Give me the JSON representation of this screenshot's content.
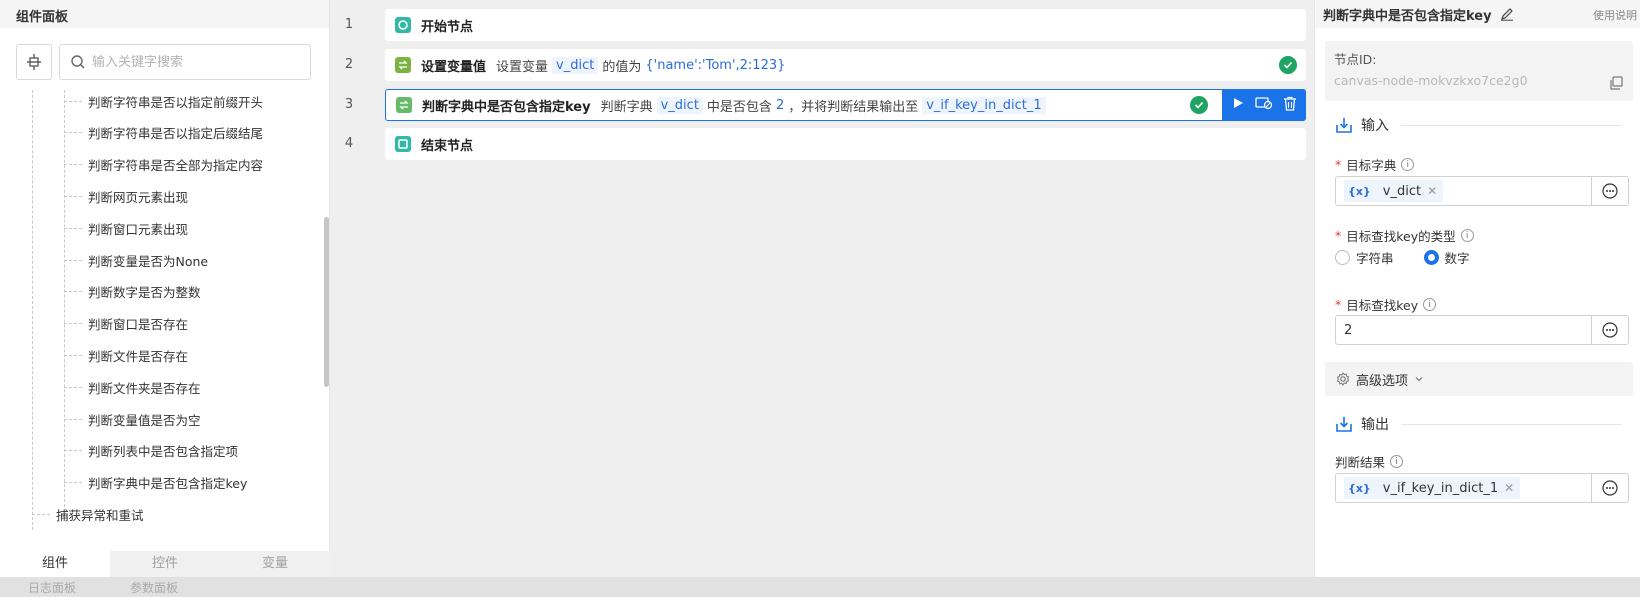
{
  "left_panel": {
    "title": "组件面板",
    "search_placeholder": "输入关键字搜索",
    "tree_items": [
      "判断字符串是否以指定前缀开头",
      "判断字符串是否以指定后缀结尾",
      "判断字符串是否全部为指定内容",
      "判断网页元素出现",
      "判断窗口元素出现",
      "判断变量是否为None",
      "判断数字是否为整数",
      "判断窗口是否存在",
      "判断文件是否存在",
      "判断文件夹是否存在",
      "判断变量值是否为空",
      "判断列表中是否包含指定项",
      "判断字典中是否包含指定key"
    ],
    "tree_top_item": "捕获异常和重试",
    "tabs": [
      "组件",
      "控件",
      "变量"
    ]
  },
  "bottom_tabs": [
    "日志面板",
    "参数面板"
  ],
  "canvas": {
    "rows": [
      {
        "num": "1",
        "title": "开始节点"
      },
      {
        "num": "2",
        "title": "设置变量值",
        "desc1": "设置变量",
        "var": "v_dict",
        "desc2": "的值为",
        "value": "{'name':'Tom',2:123}"
      },
      {
        "num": "3",
        "title": "判断字典中是否包含指定key",
        "desc1": "判断字典",
        "var": "v_dict",
        "desc2": "中是否包含",
        "value": "2",
        "desc3": "，并将判断结果输出至",
        "var2": "v_if_key_in_dict_1"
      },
      {
        "num": "4",
        "title": "结束节点"
      }
    ]
  },
  "right_panel": {
    "title": "判断字典中是否包含指定key",
    "help": "使用说明",
    "node_id_label": "节点ID:",
    "node_id_value": "canvas-node-mokvzkxo7ce2g0",
    "input_section": "输入",
    "field_dict_label": "目标字典",
    "field_dict_value": "v_dict",
    "field_keytype_label": "目标查找key的类型",
    "radio_string": "字符串",
    "radio_number": "数字",
    "field_key_label": "目标查找key",
    "field_key_value": "2",
    "advanced": "高级选项",
    "output_section": "输出",
    "field_result_label": "判断结果",
    "field_result_value": "v_if_key_in_dict_1",
    "var_badge": "{x}"
  },
  "colors": {
    "accent": "#1a73e8",
    "success": "#1fa463",
    "var_text": "#2c6dd5",
    "required": "#e53935"
  }
}
